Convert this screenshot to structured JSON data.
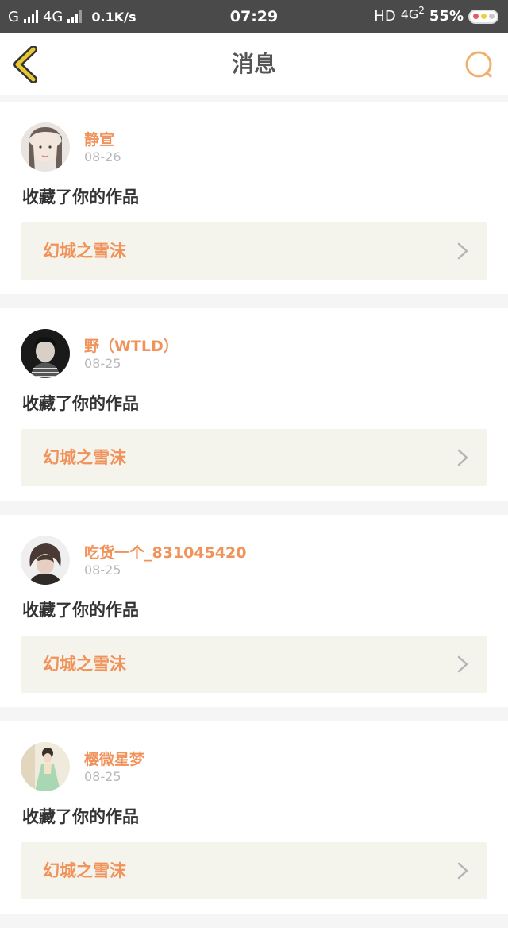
{
  "status_bar": {
    "carrier": "G",
    "network": "4G",
    "speed": "0.1K/s",
    "time": "07:29",
    "hd": "HD",
    "net_right": "4G",
    "sim": "2",
    "battery": "55%"
  },
  "nav": {
    "title": "消息"
  },
  "colors": {
    "accent": "#f0925a",
    "back_icon": "#e8c832",
    "search_icon": "#f0b070",
    "status_bar": "#4a4a4a"
  },
  "messages": [
    {
      "username": "静宣",
      "date": "08-26",
      "action": "收藏了你的作品",
      "work_title": "幻城之雪沫",
      "avatar": "avatar-girl-light"
    },
    {
      "username": "野（WTLD）",
      "date": "08-25",
      "action": "收藏了你的作品",
      "work_title": "幻城之雪沫",
      "avatar": "avatar-girl-dark"
    },
    {
      "username": "吃货一个_831045420",
      "date": "08-25",
      "action": "收藏了你的作品",
      "work_title": "幻城之雪沫",
      "avatar": "avatar-girl-shorthair"
    },
    {
      "username": "樱微星梦",
      "date": "08-25",
      "action": "收藏了你的作品",
      "work_title": "幻城之雪沫",
      "avatar": "avatar-girl-dress"
    }
  ]
}
